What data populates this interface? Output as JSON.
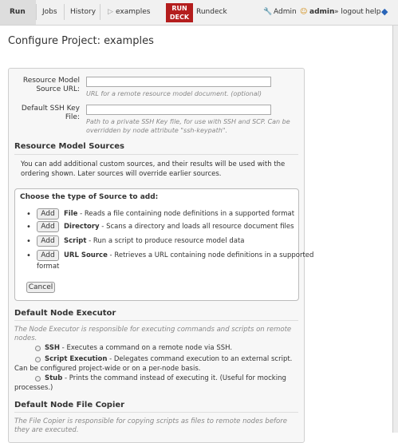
{
  "nav": {
    "run": "Run",
    "jobs": "Jobs",
    "history": "History",
    "project": "examples",
    "logo_line1": "RUN",
    "logo_line2": "DECK",
    "app": "Rundeck",
    "admin": "Admin",
    "user": "admin",
    "logout": "» logout",
    "help": "help"
  },
  "page_title": "Configure Project: examples",
  "resource_model": {
    "url_label_1": "Resource Model",
    "url_label_2": "Source URL:",
    "url_value": "",
    "url_hint": "URL for a remote resource model document. (optional)",
    "ssh_label_1": "Default SSH Key",
    "ssh_label_2": "File:",
    "ssh_value": "",
    "ssh_hint_1": "Path to a private SSH Key file, for use with SSH and SCP. Can be",
    "ssh_hint_2": "overridden by node attribute \"ssh-keypath\"."
  },
  "sources": {
    "heading": "Resource Model Sources",
    "desc_1": "You can add additional custom sources, and their results will be used with the",
    "desc_2": "ordering shown. Later sources will override earlier sources.",
    "choose_heading": "Choose the type of Source to add:",
    "add_label": "Add",
    "cancel_label": "Cancel",
    "items": [
      {
        "name": "File",
        "desc": " - Reads a file containing node definitions in a supported format"
      },
      {
        "name": "Directory",
        "desc": " - Scans a directory and loads all resource document files"
      },
      {
        "name": "Script",
        "desc": " - Run a script to produce resource model data"
      },
      {
        "name": "URL Source",
        "desc": " - Retrieves a URL containing node definitions in a supported"
      }
    ],
    "url_wrap": "format"
  },
  "executor": {
    "heading": "Default Node Executor",
    "desc_1": "The Node Executor is responsible for executing commands and scripts on remote",
    "desc_2": "nodes.",
    "ssh_name": "SSH",
    "ssh_desc": " - Executes a command on a remote node via SSH.",
    "script_name": "Script Execution",
    "script_desc": " - Delegates command execution to an external script.",
    "script_wrap": "Can be configured project-wide or on a per-node basis.",
    "stub_name": "Stub",
    "stub_desc": " - Prints the command instead of executing it. (Useful for mocking",
    "stub_wrap": "processes.)"
  },
  "copier": {
    "heading": "Default Node File Copier",
    "desc_1": "The File Copier is responsible for copying scripts as files to remote nodes before",
    "desc_2": "they are executed."
  }
}
